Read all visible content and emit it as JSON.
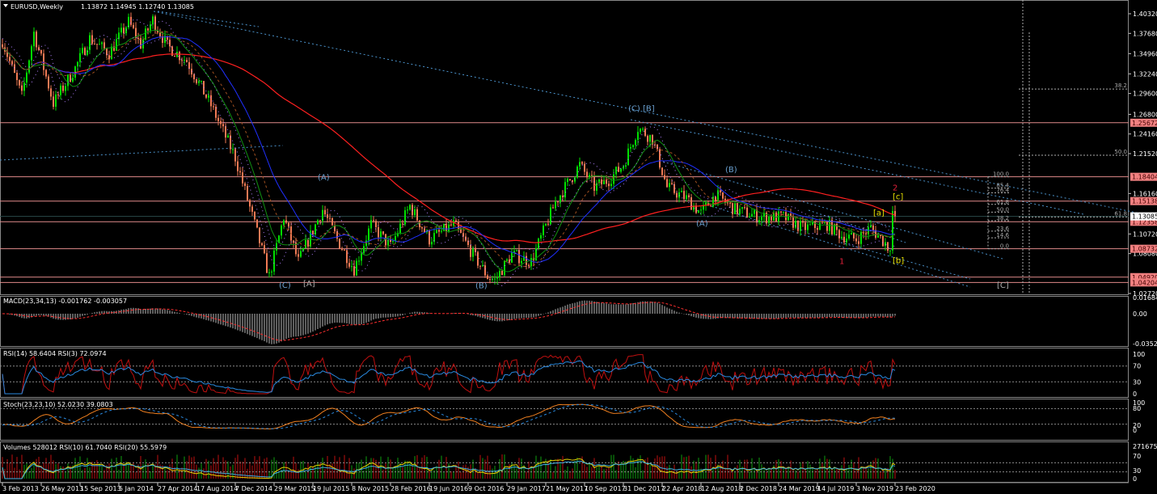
{
  "header": {
    "symbol": "EURUSD,Weekly",
    "ohlc": "1.13872 1.14945 1.12740 1.13085"
  },
  "indicators": {
    "macd": "MACD(23,34,13) -0.001762 -0.003057",
    "rsi": "RSI(14) 58.6404  RSI(3) 72.0974",
    "stoch": "Stoch(23,23,10) 52.0230 39.0803",
    "volumes": "Volumes 528012  RSI(10) 61.7040  RSI(20) 55.5979"
  },
  "colors": {
    "bull": "#00e000",
    "bear": "#f07a55",
    "level": "#e08a8a",
    "ma_slow": "#ff2020",
    "ma_mid": "#2030ff",
    "ma_fast": "#109010",
    "trend": "#4a90c8",
    "wave": "#6aa0d0"
  },
  "price_axis": [
    "1.40320",
    "1.37680",
    "1.34960",
    "1.32240",
    "1.29600",
    "1.26800",
    "1.24160",
    "1.21520",
    "1.16160",
    "1.10720",
    "1.08080",
    "1.02720"
  ],
  "levels": [
    {
      "price": 1.25672,
      "label": "1.25672"
    },
    {
      "price": 1.18404,
      "label": "1.18404"
    },
    {
      "price": 1.15138,
      "label": "1.15138"
    },
    {
      "price": 1.12358,
      "label": "1.12358"
    },
    {
      "price": 1.08732,
      "label": "1.08732"
    },
    {
      "price": 1.0492,
      "label": "1.04920"
    },
    {
      "price": 1.04204,
      "label": "1.04204"
    }
  ],
  "current_price": {
    "price": 1.13085,
    "label": "1.13085"
  },
  "fib_levels": [
    {
      "price": 1.18404,
      "label": "100.0"
    },
    {
      "price": 1.1688,
      "label": "85.4"
    },
    {
      "price": 1.1625,
      "label": "76.4"
    },
    {
      "price": 1.147,
      "label": "61.8"
    },
    {
      "price": 1.1365,
      "label": "50.0"
    },
    {
      "price": 1.125,
      "label": "38.2"
    },
    {
      "price": 1.111,
      "label": "23.6"
    },
    {
      "price": 1.102,
      "label": "14.6"
    },
    {
      "price": 1.08732,
      "label": "0.0"
    }
  ],
  "fib_big": [
    {
      "price": 1.302,
      "label": "38.2"
    },
    {
      "price": 1.213,
      "label": "50.0"
    },
    {
      "price": 1.13,
      "label": "61.8"
    }
  ],
  "wave_labels": [
    {
      "text": "(C)",
      "week": 116,
      "price": 1.035,
      "color": "#6aa0d0"
    },
    {
      "text": "[A]",
      "week": 126,
      "price": 1.037,
      "color": "#aaaaaa"
    },
    {
      "text": "(A)",
      "week": 132,
      "price": 1.18,
      "color": "#6aa0d0"
    },
    {
      "text": "(B)",
      "week": 197,
      "price": 1.034,
      "color": "#6aa0d0"
    },
    {
      "text": "(C) [B]",
      "week": 260,
      "price": 1.272,
      "color": "#6aa0d0"
    },
    {
      "text": "(B)",
      "week": 300,
      "price": 1.19,
      "color": "#6aa0d0"
    },
    {
      "text": "(A)",
      "week": 288,
      "price": 1.118,
      "color": "#6aa0d0"
    },
    {
      "text": "1",
      "week": 347,
      "price": 1.067,
      "color": "#e0203a"
    },
    {
      "text": "2",
      "week": 369,
      "price": 1.166,
      "color": "#e0203a"
    },
    {
      "text": "[c]",
      "week": 369,
      "price": 1.154,
      "color": "#e8e000"
    },
    {
      "text": "[a]",
      "week": 361,
      "price": 1.132,
      "color": "#e8e000"
    },
    {
      "text": "[b]",
      "week": 369,
      "price": 1.068,
      "color": "#e8e000"
    },
    {
      "text": "[C]",
      "week": 412,
      "price": 1.035,
      "color": "#aaaaaa"
    }
  ],
  "time_axis": [
    "3 Feb 2013",
    "26 May 2013",
    "15 Sep 2013",
    "5 Jan 2014",
    "27 Apr 2014",
    "17 Aug 2014",
    "7 Dec 2014",
    "29 Mar 2015",
    "19 Jul 2015",
    "8 Nov 2015",
    "28 Feb 2016",
    "19 Jun 2016",
    "9 Oct 2016",
    "29 Jan 2017",
    "21 May 2017",
    "10 Sep 2017",
    "31 Dec 2017",
    "22 Apr 2018",
    "12 Aug 2018",
    "2 Dec 2018",
    "24 Mar 2019",
    "14 Jul 2019",
    "3 Nov 2019",
    "23 Feb 2020"
  ],
  "macd_axis": [
    "0.016848",
    "0.00",
    "-0.03525"
  ],
  "rsi_axis": [
    "100",
    "70",
    "30",
    "0"
  ],
  "stoch_axis": [
    "100",
    "80",
    "20",
    "0"
  ],
  "vol_axis": [
    "2716750",
    "70",
    "30",
    "0"
  ],
  "chart_data": {
    "type": "candlestick",
    "symbol": "EURUSD",
    "timeframe": "Weekly",
    "ylim": [
      1.0272,
      1.4032
    ],
    "pivots_week_price": [
      [
        0,
        1.367
      ],
      [
        8,
        1.292
      ],
      [
        13,
        1.378
      ],
      [
        21,
        1.283
      ],
      [
        30,
        1.33
      ],
      [
        36,
        1.37
      ],
      [
        44,
        1.35
      ],
      [
        52,
        1.392
      ],
      [
        57,
        1.362
      ],
      [
        62,
        1.395
      ],
      [
        68,
        1.36
      ],
      [
        76,
        1.34
      ],
      [
        86,
        1.28
      ],
      [
        96,
        1.21
      ],
      [
        104,
        1.12
      ],
      [
        110,
        1.05
      ],
      [
        116,
        1.13
      ],
      [
        122,
        1.07
      ],
      [
        132,
        1.14
      ],
      [
        138,
        1.1
      ],
      [
        145,
        1.06
      ],
      [
        152,
        1.12
      ],
      [
        160,
        1.09
      ],
      [
        168,
        1.145
      ],
      [
        176,
        1.1
      ],
      [
        186,
        1.12
      ],
      [
        194,
        1.08
      ],
      [
        200,
        1.05
      ],
      [
        203,
        1.045
      ],
      [
        210,
        1.08
      ],
      [
        218,
        1.07
      ],
      [
        228,
        1.15
      ],
      [
        238,
        1.2
      ],
      [
        244,
        1.17
      ],
      [
        250,
        1.18
      ],
      [
        256,
        1.2
      ],
      [
        262,
        1.25
      ],
      [
        268,
        1.235
      ],
      [
        274,
        1.17
      ],
      [
        282,
        1.155
      ],
      [
        288,
        1.135
      ],
      [
        294,
        1.16
      ],
      [
        302,
        1.14
      ],
      [
        312,
        1.13
      ],
      [
        322,
        1.13
      ],
      [
        330,
        1.115
      ],
      [
        340,
        1.12
      ],
      [
        346,
        1.105
      ],
      [
        352,
        1.1
      ],
      [
        358,
        1.115
      ],
      [
        364,
        1.095
      ],
      [
        366,
        1.085
      ],
      [
        367,
        1.138
      ],
      [
        368,
        1.13085
      ]
    ]
  }
}
